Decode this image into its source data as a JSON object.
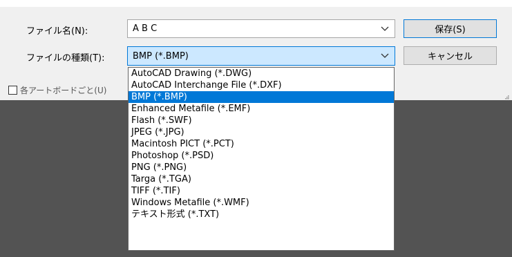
{
  "dialog": {
    "filename_label": "ファイル名(N):",
    "filename_value": "A B C",
    "filetype_label": "ファイルの種類(T):",
    "filetype_value": "BMP (*.BMP)",
    "save_button": "保存(S)",
    "cancel_button": "キャンセル",
    "artboards_checkbox_label": "各アートボードごと(U)",
    "artboards_checkbox_checked": false
  },
  "filetypes": {
    "selected_index": 2,
    "options": [
      "AutoCAD Drawing (*.DWG)",
      "AutoCAD Interchange File (*.DXF)",
      "BMP (*.BMP)",
      "Enhanced Metafile (*.EMF)",
      "Flash (*.SWF)",
      "JPEG (*.JPG)",
      "Macintosh PICT (*.PCT)",
      "Photoshop (*.PSD)",
      "PNG (*.PNG)",
      "Targa (*.TGA)",
      "TIFF (*.TIF)",
      "Windows Metafile (*.WMF)",
      "テキスト形式 (*.TXT)"
    ]
  },
  "colors": {
    "selection": "#0078d7",
    "combo_focus_bg": "#cce8ff",
    "dark_area": "#535353",
    "dialog_bg": "#f0f0f0"
  }
}
